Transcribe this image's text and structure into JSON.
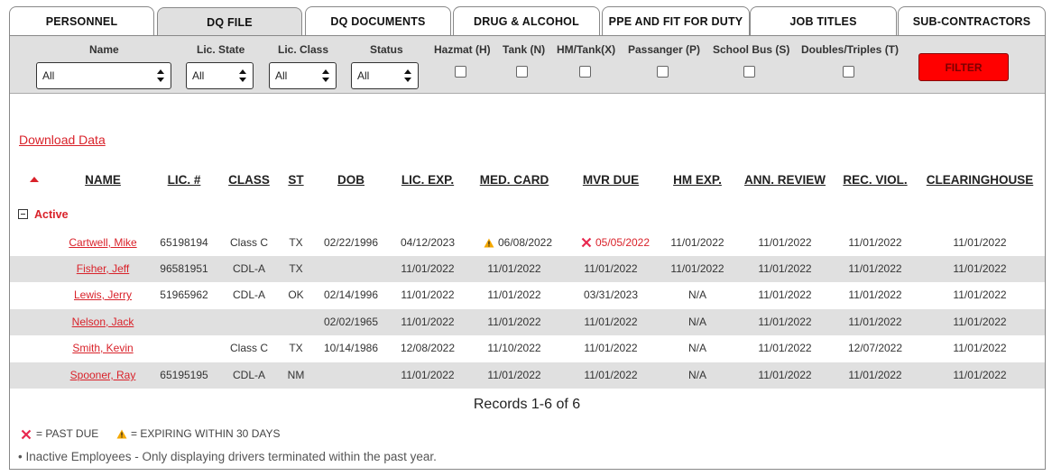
{
  "tabs": [
    {
      "label": "PERSONNEL"
    },
    {
      "label": "DQ FILE"
    },
    {
      "label": "DQ DOCUMENTS"
    },
    {
      "label": "DRUG & ALCOHOL"
    },
    {
      "label": "PPE AND FIT FOR DUTY"
    },
    {
      "label": "JOB TITLES"
    },
    {
      "label": "SUB-CONTRACTORS"
    }
  ],
  "active_tab": "DQ FILE",
  "filters": {
    "name": {
      "label": "Name",
      "value": "All"
    },
    "lic_state": {
      "label": "Lic. State",
      "value": "All"
    },
    "lic_class": {
      "label": "Lic. Class",
      "value": "All"
    },
    "status": {
      "label": "Status",
      "value": "All"
    },
    "checks": [
      {
        "label": "Hazmat (H)",
        "checked": false
      },
      {
        "label": "Tank (N)",
        "checked": false
      },
      {
        "label": "HM/Tank(X)",
        "checked": false
      },
      {
        "label": "Passanger (P)",
        "checked": false
      },
      {
        "label": "School Bus (S)",
        "checked": false
      },
      {
        "label": "Doubles/Triples (T)",
        "checked": false
      }
    ],
    "button": "FILTER"
  },
  "download_link": "Download Data",
  "columns": {
    "name": "NAME",
    "lic": "LIC. #",
    "class": "CLASS",
    "st": "ST",
    "dob": "DOB",
    "lic_exp": "LIC. EXP.",
    "med_card": "MED. CARD",
    "mvr_due": "MVR DUE",
    "hm_exp": "HM EXP.",
    "ann_review": "ANN. REVIEW",
    "rec_viol": "REC. VIOL.",
    "clearinghouse": "CLEARINGHOUSE"
  },
  "group": {
    "label": "Active"
  },
  "rows": [
    {
      "name": "Cartwell, Mike",
      "lic": "65198194",
      "class": "Class C",
      "st": "TX",
      "dob": "02/22/1996",
      "lic_exp": "04/12/2023",
      "med_card": "06/08/2022",
      "mvr_due": "05/05/2022",
      "hm_exp": "11/01/2022",
      "ann_review": "11/01/2022",
      "rec_viol": "11/01/2022",
      "clearinghouse": "11/01/2022"
    },
    {
      "name": "Fisher, Jeff",
      "lic": "96581951",
      "class": "CDL-A",
      "st": "TX",
      "dob": "",
      "lic_exp": "11/01/2022",
      "med_card": "11/01/2022",
      "mvr_due": "11/01/2022",
      "hm_exp": "11/01/2022",
      "ann_review": "11/01/2022",
      "rec_viol": "11/01/2022",
      "clearinghouse": "11/01/2022"
    },
    {
      "name": "Lewis, Jerry",
      "lic": "51965962",
      "class": "CDL-A",
      "st": "OK",
      "dob": "02/14/1996",
      "lic_exp": "11/01/2022",
      "med_card": "11/01/2022",
      "mvr_due": "03/31/2023",
      "hm_exp": "N/A",
      "ann_review": "11/01/2022",
      "rec_viol": "11/01/2022",
      "clearinghouse": "11/01/2022"
    },
    {
      "name": "Nelson, Jack",
      "lic": "",
      "class": "",
      "st": "",
      "dob": "02/02/1965",
      "lic_exp": "11/01/2022",
      "med_card": "11/01/2022",
      "mvr_due": "11/01/2022",
      "hm_exp": "N/A",
      "ann_review": "11/01/2022",
      "rec_viol": "11/01/2022",
      "clearinghouse": "11/01/2022"
    },
    {
      "name": "Smith, Kevin",
      "lic": "",
      "class": "Class C",
      "st": "TX",
      "dob": "10/14/1986",
      "lic_exp": "12/08/2022",
      "med_card": "11/10/2022",
      "mvr_due": "11/01/2022",
      "hm_exp": "N/A",
      "ann_review": "11/01/2022",
      "rec_viol": "12/07/2022",
      "clearinghouse": "11/01/2022"
    },
    {
      "name": "Spooner, Ray",
      "lic": "65195195",
      "class": "CDL-A",
      "st": "NM",
      "dob": "",
      "lic_exp": "11/01/2022",
      "med_card": "11/01/2022",
      "mvr_due": "11/01/2022",
      "hm_exp": "N/A",
      "ann_review": "11/01/2022",
      "rec_viol": "11/01/2022",
      "clearinghouse": "11/01/2022"
    }
  ],
  "status_flags": {
    "warning_icon": "warning-triangle-icon",
    "past_due_icon": "x-mark-icon"
  },
  "records_text": "Records 1-6 of 6",
  "legend": {
    "past_due": "= PAST DUE",
    "expiring": "= EXPIRING WITHIN 30 DAYS"
  },
  "note": "• Inactive Employees - Only displaying drivers terminated within the past year.",
  "colors": {
    "accent_red": "#d9222a",
    "filter_button": "#ff0000",
    "bar_gray": "#e0e0e0",
    "warning_yellow": "#f5a800"
  }
}
